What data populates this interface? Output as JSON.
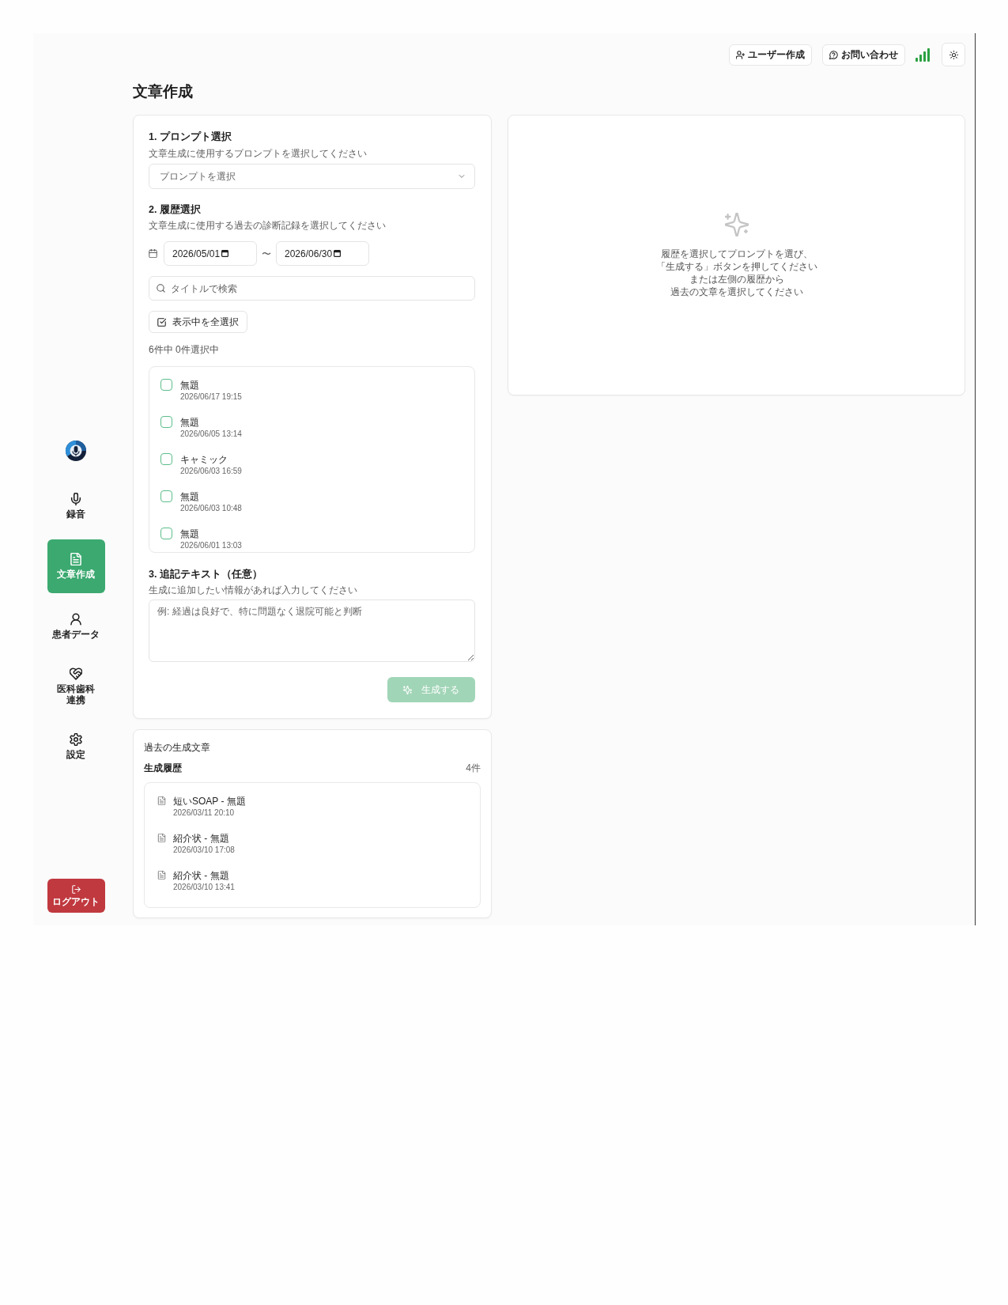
{
  "header": {
    "actions": [
      {
        "label": "ユーザー作成"
      },
      {
        "label": "お問い合わせ"
      }
    ]
  },
  "sidebar": {
    "items": [
      {
        "label": "録音",
        "selected": false
      },
      {
        "label": "文章作成",
        "selected": true
      },
      {
        "label": "患者データ",
        "selected": false
      },
      {
        "label": "医科歯科連携",
        "selected": false
      },
      {
        "label": "設定",
        "selected": false
      }
    ],
    "logout": {
      "label": "ログアウト"
    }
  },
  "page": {
    "title": "文章作成"
  },
  "form": {
    "prompt_section": {
      "title": "1. プロンプト選択",
      "hint": "文章生成に使用するプロンプトを選択してください",
      "select": {
        "placeholder": "プロンプトを選択"
      }
    },
    "history_section": {
      "title": "2. 履歴選択",
      "hint": "文章生成に使用する過去の診断記録を選択してください",
      "date_from": "2026/05/01",
      "separator": "〜",
      "date_to": "2026/06/30",
      "search": {
        "placeholder": "タイトルで検索"
      },
      "select_all": "表示中を全選択",
      "count": "6件中 0件選択中",
      "records": [
        {
          "title": "無題",
          "date": "2026/06/17 19:15",
          "checked": false
        },
        {
          "title": "無題",
          "date": "2026/06/05 13:14",
          "checked": false
        },
        {
          "title": "キャミック",
          "date": "2026/06/03 16:59",
          "checked": false
        },
        {
          "title": "無題",
          "date": "2026/06/03 10:48",
          "checked": false
        },
        {
          "title": "無題",
          "date": "2026/06/01 13:03",
          "checked": false
        }
      ]
    },
    "note_section": {
      "title": "3. 追記テキスト（任意）",
      "hint": "生成に追加したい情報があれば入力してください",
      "textarea": {
        "placeholder": "例: 経過は良好で、特に問題なく退院可能と判断"
      }
    },
    "generate_button": {
      "label": "生成する",
      "disabled": true
    }
  },
  "history_panel": {
    "title": "過去の生成文章",
    "subtitle": "生成履歴",
    "count": "4件",
    "items": [
      {
        "title": "短いSOAP - 無題",
        "date": "2026/03/11 20:10"
      },
      {
        "title": "紹介状 - 無題",
        "date": "2026/03/10 17:08"
      },
      {
        "title": "紹介状 - 無題",
        "date": "2026/03/10 13:41"
      }
    ]
  },
  "preview": {
    "message_lines": [
      "履歴を選択してプロンプトを選び、",
      "「生成する」ボタンを押してください",
      "または左側の履歴から",
      "過去の文章を選択してください"
    ]
  }
}
